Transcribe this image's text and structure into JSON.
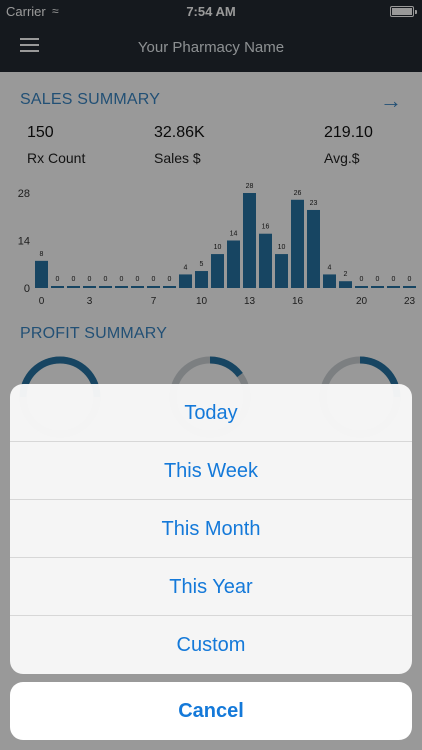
{
  "status_bar": {
    "carrier": "Carrier",
    "time": "7:54 AM"
  },
  "nav": {
    "title": "Your Pharmacy Name",
    "menu_icon": "hamburger-menu-icon"
  },
  "sales": {
    "title": "SALES SUMMARY",
    "arrow_icon": "arrow-right-icon",
    "stats": [
      {
        "value": "150",
        "label": "Rx Count"
      },
      {
        "value": "32.86K",
        "label": "Sales $"
      },
      {
        "value": "219.10",
        "label": "Avg.$"
      }
    ]
  },
  "chart_data": {
    "type": "bar",
    "x": [
      0,
      1,
      2,
      3,
      4,
      5,
      6,
      7,
      8,
      9,
      10,
      11,
      12,
      13,
      14,
      15,
      16,
      17,
      18,
      19,
      20,
      21,
      22,
      23
    ],
    "values": [
      8,
      0,
      0,
      0,
      0,
      0,
      0,
      0,
      0,
      4,
      5,
      10,
      14,
      28,
      16,
      10,
      26,
      23,
      4,
      2,
      0,
      0,
      0,
      0
    ],
    "x_tick_labels": [
      "0",
      "3",
      "7",
      "10",
      "13",
      "16",
      "20",
      "23"
    ],
    "y_tick_labels": [
      "28",
      "14",
      "0"
    ],
    "ylim": [
      0,
      28
    ],
    "color": "#2774a3"
  },
  "profit": {
    "title": "PROFIT SUMMARY",
    "gauge_color": "#2774a3",
    "gauge_track": "#cfd4d8"
  },
  "action_sheet": {
    "options": [
      "Today",
      "This Week",
      "This Month",
      "This Year",
      "Custom"
    ],
    "cancel": "Cancel",
    "color": "#1479d9"
  }
}
